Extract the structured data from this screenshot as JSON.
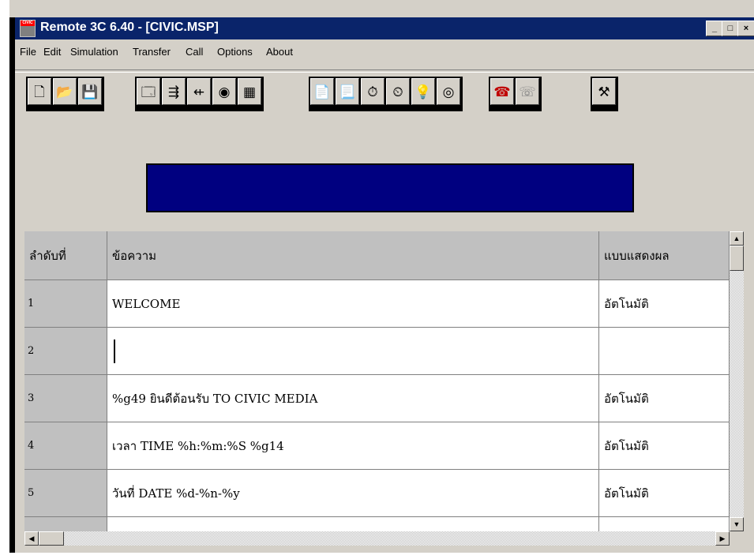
{
  "window": {
    "app_icon_label": "CIVIC",
    "title": "Remote 3C 6.40 - [CIVIC.MSP]",
    "minimize_glyph": "_",
    "maximize_glyph": "□",
    "close_glyph": "×"
  },
  "menu": [
    "File",
    "Edit",
    "Simulation",
    "Transfer",
    "Call",
    "Options",
    "About"
  ],
  "toolbar": {
    "groups": [
      [
        {
          "icon": "new-document-icon",
          "glyph": "🗋"
        },
        {
          "icon": "open-folder-icon",
          "glyph": "📂"
        },
        {
          "icon": "save-disk-icon",
          "glyph": "💾"
        }
      ],
      [
        {
          "icon": "properties-icon",
          "glyph": "🗔"
        },
        {
          "icon": "insert-line-icon",
          "glyph": "⇶"
        },
        {
          "icon": "delete-line-icon",
          "glyph": "⇷"
        },
        {
          "icon": "preview-icon",
          "glyph": "◉"
        },
        {
          "icon": "graphics-icon",
          "glyph": "▦"
        }
      ],
      [
        {
          "icon": "send-page-icon",
          "glyph": "📄"
        },
        {
          "icon": "receive-page-icon",
          "glyph": "📃"
        },
        {
          "icon": "send-clock-icon",
          "glyph": "⏱"
        },
        {
          "icon": "receive-clock-icon",
          "glyph": "⏲"
        },
        {
          "icon": "light-bulb-icon",
          "glyph": "💡"
        },
        {
          "icon": "disc-icon",
          "glyph": "◎"
        }
      ],
      [
        {
          "icon": "dial-phone-icon",
          "glyph": "☎"
        },
        {
          "icon": "hangup-phone-icon",
          "glyph": "☏"
        }
      ],
      [
        {
          "icon": "tools-icon",
          "glyph": "⚒"
        }
      ]
    ]
  },
  "table": {
    "headers": [
      "ลำดับที่",
      "ข้อความ",
      "แบบแสดงผล"
    ],
    "rows": [
      {
        "no": "1",
        "message": "WELCOME",
        "mode": "อัตโนมัติ"
      },
      {
        "no": "2",
        "message": "",
        "mode": ""
      },
      {
        "no": "3",
        "message": "%g49 ยินดีต้อนรับ TO CIVIC MEDIA",
        "mode": "อัตโนมัติ"
      },
      {
        "no": "4",
        "message": "เวลา TIME %h:%m:%S %g14",
        "mode": "อัตโนมัติ"
      },
      {
        "no": "5",
        "message": "วันที่ DATE %d-%n-%y",
        "mode": "อัตโนมัติ"
      }
    ]
  },
  "scroll": {
    "up": "▲",
    "down": "▼",
    "left": "◀",
    "right": "▶"
  },
  "colors": {
    "titlebar": "#0a246a",
    "display_panel": "#000080",
    "face": "#d4d0c8"
  }
}
